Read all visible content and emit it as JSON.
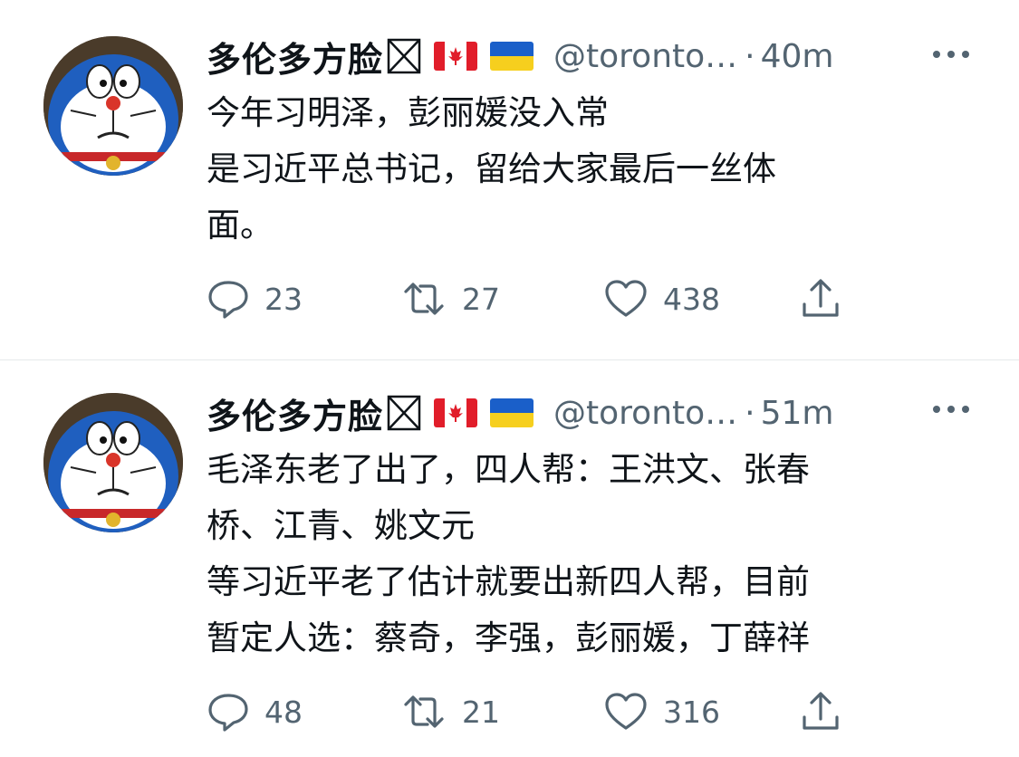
{
  "tweets": [
    {
      "name": "多伦多方脸",
      "handle": "@toronto…",
      "separator": "·",
      "time": "40m",
      "lines": [
        "今年习明泽，彭丽媛没入常",
        "是习近平总书记，留给大家最后一丝体",
        "面。"
      ],
      "stats": {
        "replies": "23",
        "retweets": "27",
        "likes": "438"
      }
    },
    {
      "name": "多伦多方脸",
      "handle": "@toronto…",
      "separator": "·",
      "time": "51m",
      "lines": [
        "毛泽东老了出了，四人帮：王洪文、张春",
        "桥、江青、姚文元",
        "等习近平老了估计就要出新四人帮，目前",
        "暂定人选：蔡奇，李强，彭丽媛，丁薛祥"
      ],
      "stats": {
        "replies": "48",
        "retweets": "21",
        "likes": "316"
      }
    }
  ],
  "icons": {
    "name_box": "x-box-icon",
    "flag_1": "canada-flag-icon",
    "flag_2": "ukraine-flag-icon",
    "more": "more-options-icon",
    "reply": "reply-icon",
    "retweet": "retweet-icon",
    "like": "heart-icon",
    "share": "share-icon"
  },
  "colors": {
    "text": "#0f1419",
    "secondary": "#536471",
    "divider": "#e6e9ea"
  }
}
